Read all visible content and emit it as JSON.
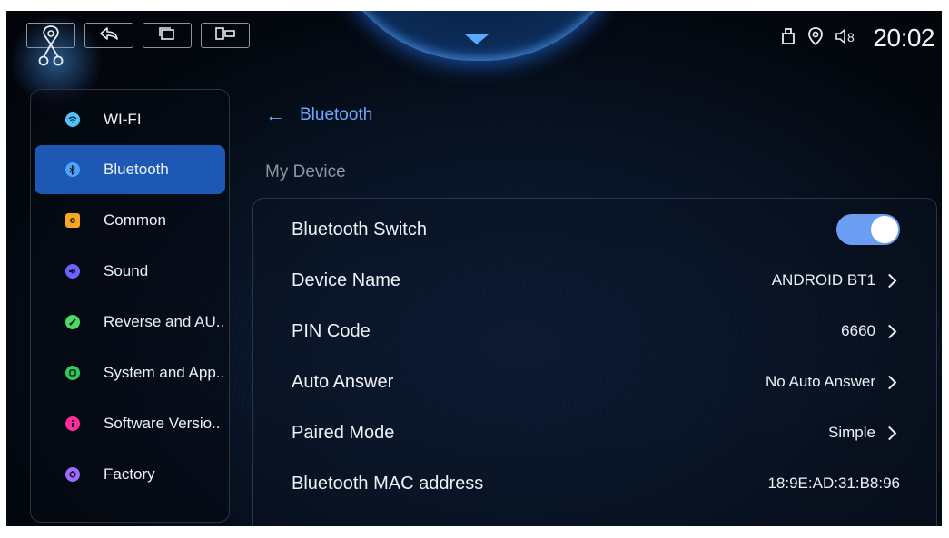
{
  "status": {
    "time": "20:02"
  },
  "topbar": {
    "icons": [
      "home-icon",
      "back-icon",
      "recent-apps-icon",
      "split-screen-icon"
    ]
  },
  "sidebar": {
    "items": [
      {
        "label": "WI-FI",
        "icon": "wifi-icon",
        "color": "#4fc3f7"
      },
      {
        "label": "Bluetooth",
        "icon": "bluetooth-icon",
        "color": "#4fa3ff",
        "active": true
      },
      {
        "label": "Common",
        "icon": "settings-icon",
        "color": "#f5a623"
      },
      {
        "label": "Sound",
        "icon": "sound-icon",
        "color": "#6c63ff"
      },
      {
        "label": "Reverse and AU..",
        "icon": "camera-icon",
        "color": "#4cd964"
      },
      {
        "label": "System and App..",
        "icon": "apps-icon",
        "color": "#34c759"
      },
      {
        "label": "Software Versio..",
        "icon": "info-icon",
        "color": "#ff2d9b"
      },
      {
        "label": "Factory",
        "icon": "factory-icon",
        "color": "#9d6bff"
      }
    ]
  },
  "header": {
    "title": "Bluetooth"
  },
  "section": {
    "label": "My Device"
  },
  "settings": {
    "bluetooth_switch": {
      "label": "Bluetooth Switch",
      "on": true
    },
    "device_name": {
      "label": "Device Name",
      "value": "ANDROID BT1"
    },
    "pin_code": {
      "label": "PIN Code",
      "value": "6660"
    },
    "auto_answer": {
      "label": "Auto Answer",
      "value": "No Auto Answer"
    },
    "paired_mode": {
      "label": "Paired Mode",
      "value": "Simple"
    },
    "mac_address": {
      "label": "Bluetooth MAC address",
      "value": "18:9E:AD:31:B8:96"
    }
  },
  "colors": {
    "accent": "#1d58b4",
    "link": "#6ea7ff",
    "toggle_on": "#6b9df2"
  }
}
